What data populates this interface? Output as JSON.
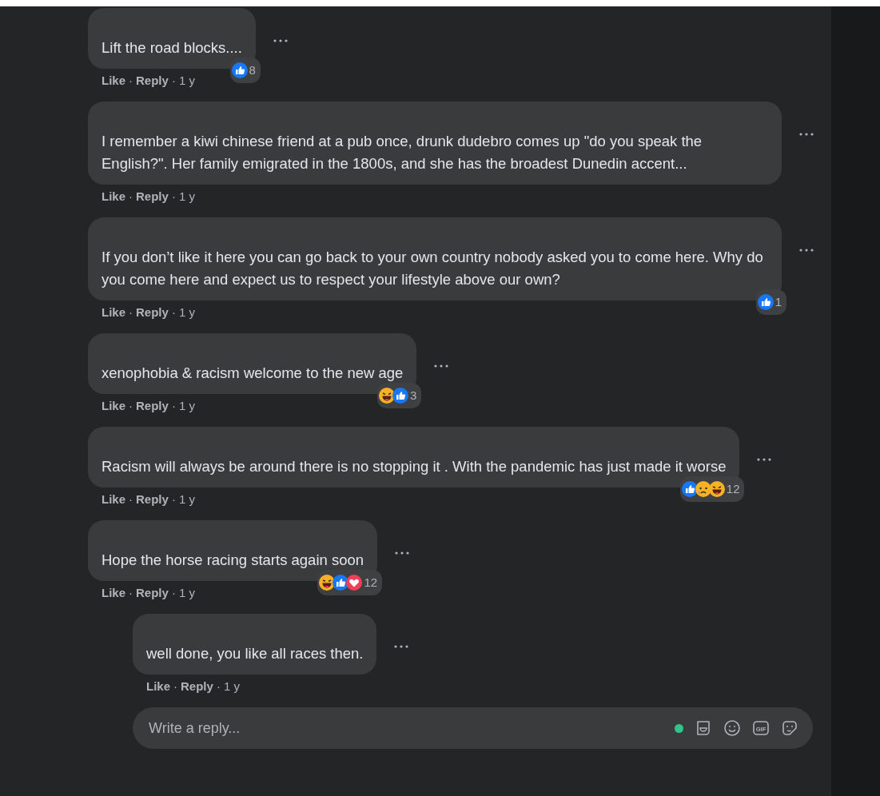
{
  "comments": [
    {
      "text": "Lift the road blocks....",
      "meta": [
        {
          "kind": "link",
          "text": "Like"
        },
        {
          "kind": "sep",
          "text": "·"
        },
        {
          "kind": "link",
          "text": "Reply"
        },
        {
          "kind": "sep",
          "text": "·"
        },
        {
          "kind": "time",
          "text": "1 y"
        }
      ],
      "reactions": [
        {
          "kind": "like"
        }
      ],
      "count": "8",
      "reply": false
    },
    {
      "text": "I remember a kiwi chinese friend at a pub once, drunk dudebro comes up \"do you speak the English?\". Her family emigrated in the 1800s, and she has the broadest Dunedin accent...",
      "meta": [
        {
          "kind": "link",
          "text": "Like"
        },
        {
          "kind": "sep",
          "text": "·"
        },
        {
          "kind": "link",
          "text": "Reply"
        },
        {
          "kind": "sep",
          "text": "·"
        },
        {
          "kind": "time",
          "text": "1 y"
        }
      ],
      "reply": false
    },
    {
      "text": "If you don’t like it here you can go back to your own country nobody asked you to come here. Why do you come here and expect us to respect your lifestyle above our own?",
      "meta": [
        {
          "kind": "link",
          "text": "Like"
        },
        {
          "kind": "sep",
          "text": "·"
        },
        {
          "kind": "link",
          "text": "Reply"
        },
        {
          "kind": "sep",
          "text": "·"
        },
        {
          "kind": "time",
          "text": "1 y"
        }
      ],
      "reactions": [
        {
          "kind": "like"
        }
      ],
      "count": "1",
      "reply": false
    },
    {
      "text": "xenophobia & racism welcome to the new age",
      "meta": [
        {
          "kind": "link",
          "text": "Like"
        },
        {
          "kind": "sep",
          "text": "·"
        },
        {
          "kind": "link",
          "text": "Reply"
        },
        {
          "kind": "sep",
          "text": "·"
        },
        {
          "kind": "time",
          "text": "1 y"
        }
      ],
      "reactions": [
        {
          "kind": "haha"
        },
        {
          "kind": "like"
        }
      ],
      "count": "3",
      "reply": false
    },
    {
      "text": "Racism will always be around there is no stopping it . With the pandemic has just made it worse",
      "meta": [
        {
          "kind": "link",
          "text": "Like"
        },
        {
          "kind": "sep",
          "text": "·"
        },
        {
          "kind": "link",
          "text": "Reply"
        },
        {
          "kind": "sep",
          "text": "·"
        },
        {
          "kind": "time",
          "text": "1 y"
        }
      ],
      "reactions": [
        {
          "kind": "like"
        },
        {
          "kind": "sad"
        },
        {
          "kind": "haha"
        }
      ],
      "count": "12",
      "reply": false
    },
    {
      "text": "Hope the horse racing starts again soon",
      "meta": [
        {
          "kind": "link",
          "text": "Like"
        },
        {
          "kind": "sep",
          "text": "·"
        },
        {
          "kind": "link",
          "text": "Reply"
        },
        {
          "kind": "sep",
          "text": "·"
        },
        {
          "kind": "time",
          "text": "1 y"
        }
      ],
      "reactions": [
        {
          "kind": "haha"
        },
        {
          "kind": "like"
        },
        {
          "kind": "love"
        }
      ],
      "count": "12",
      "reply": false
    },
    {
      "text": "well done, you like all races then.",
      "meta": [
        {
          "kind": "link",
          "text": "Like"
        },
        {
          "kind": "sep",
          "text": "·"
        },
        {
          "kind": "link",
          "text": "Reply"
        },
        {
          "kind": "sep",
          "text": "·"
        },
        {
          "kind": "time",
          "text": "1 y"
        }
      ],
      "reply": true
    }
  ],
  "reply_box": {
    "placeholder": "Write a reply...",
    "online": true,
    "gif_label": "GIF"
  }
}
